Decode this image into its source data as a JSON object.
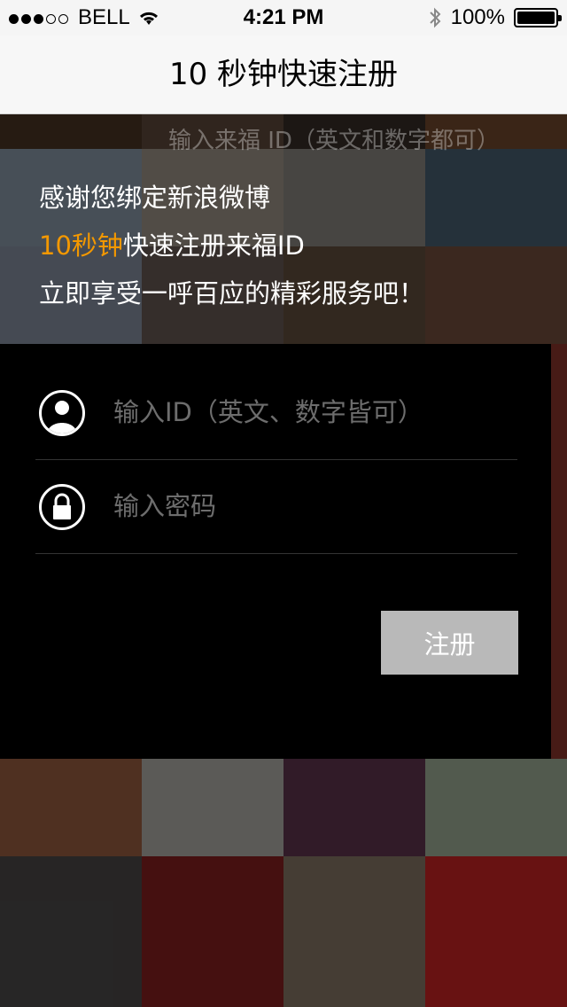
{
  "status_bar": {
    "carrier": "BELL",
    "time": "4:21 PM",
    "battery": "100%"
  },
  "nav": {
    "title": "10 秒钟快速注册"
  },
  "background_hint": "输入来福 ID（英文和数字都可）",
  "intro": {
    "line1": "感谢您绑定新浪微博",
    "line2_highlight": "10秒钟",
    "line2_rest": "快速注册来福ID",
    "line3": "立即享受一呼百应的精彩服务吧！"
  },
  "form": {
    "id_placeholder": "输入ID（英文、数字皆可）",
    "password_placeholder": "输入密码",
    "register_label": "注册"
  },
  "colors": {
    "highlight": "#f39800",
    "button_bg": "#b9b9b9",
    "panel_bg": "#000000"
  },
  "icons": {
    "signal": "signal-dots-icon",
    "wifi": "wifi-icon",
    "bluetooth": "bluetooth-icon",
    "battery": "battery-icon",
    "user": "user-icon",
    "lock": "lock-icon"
  }
}
